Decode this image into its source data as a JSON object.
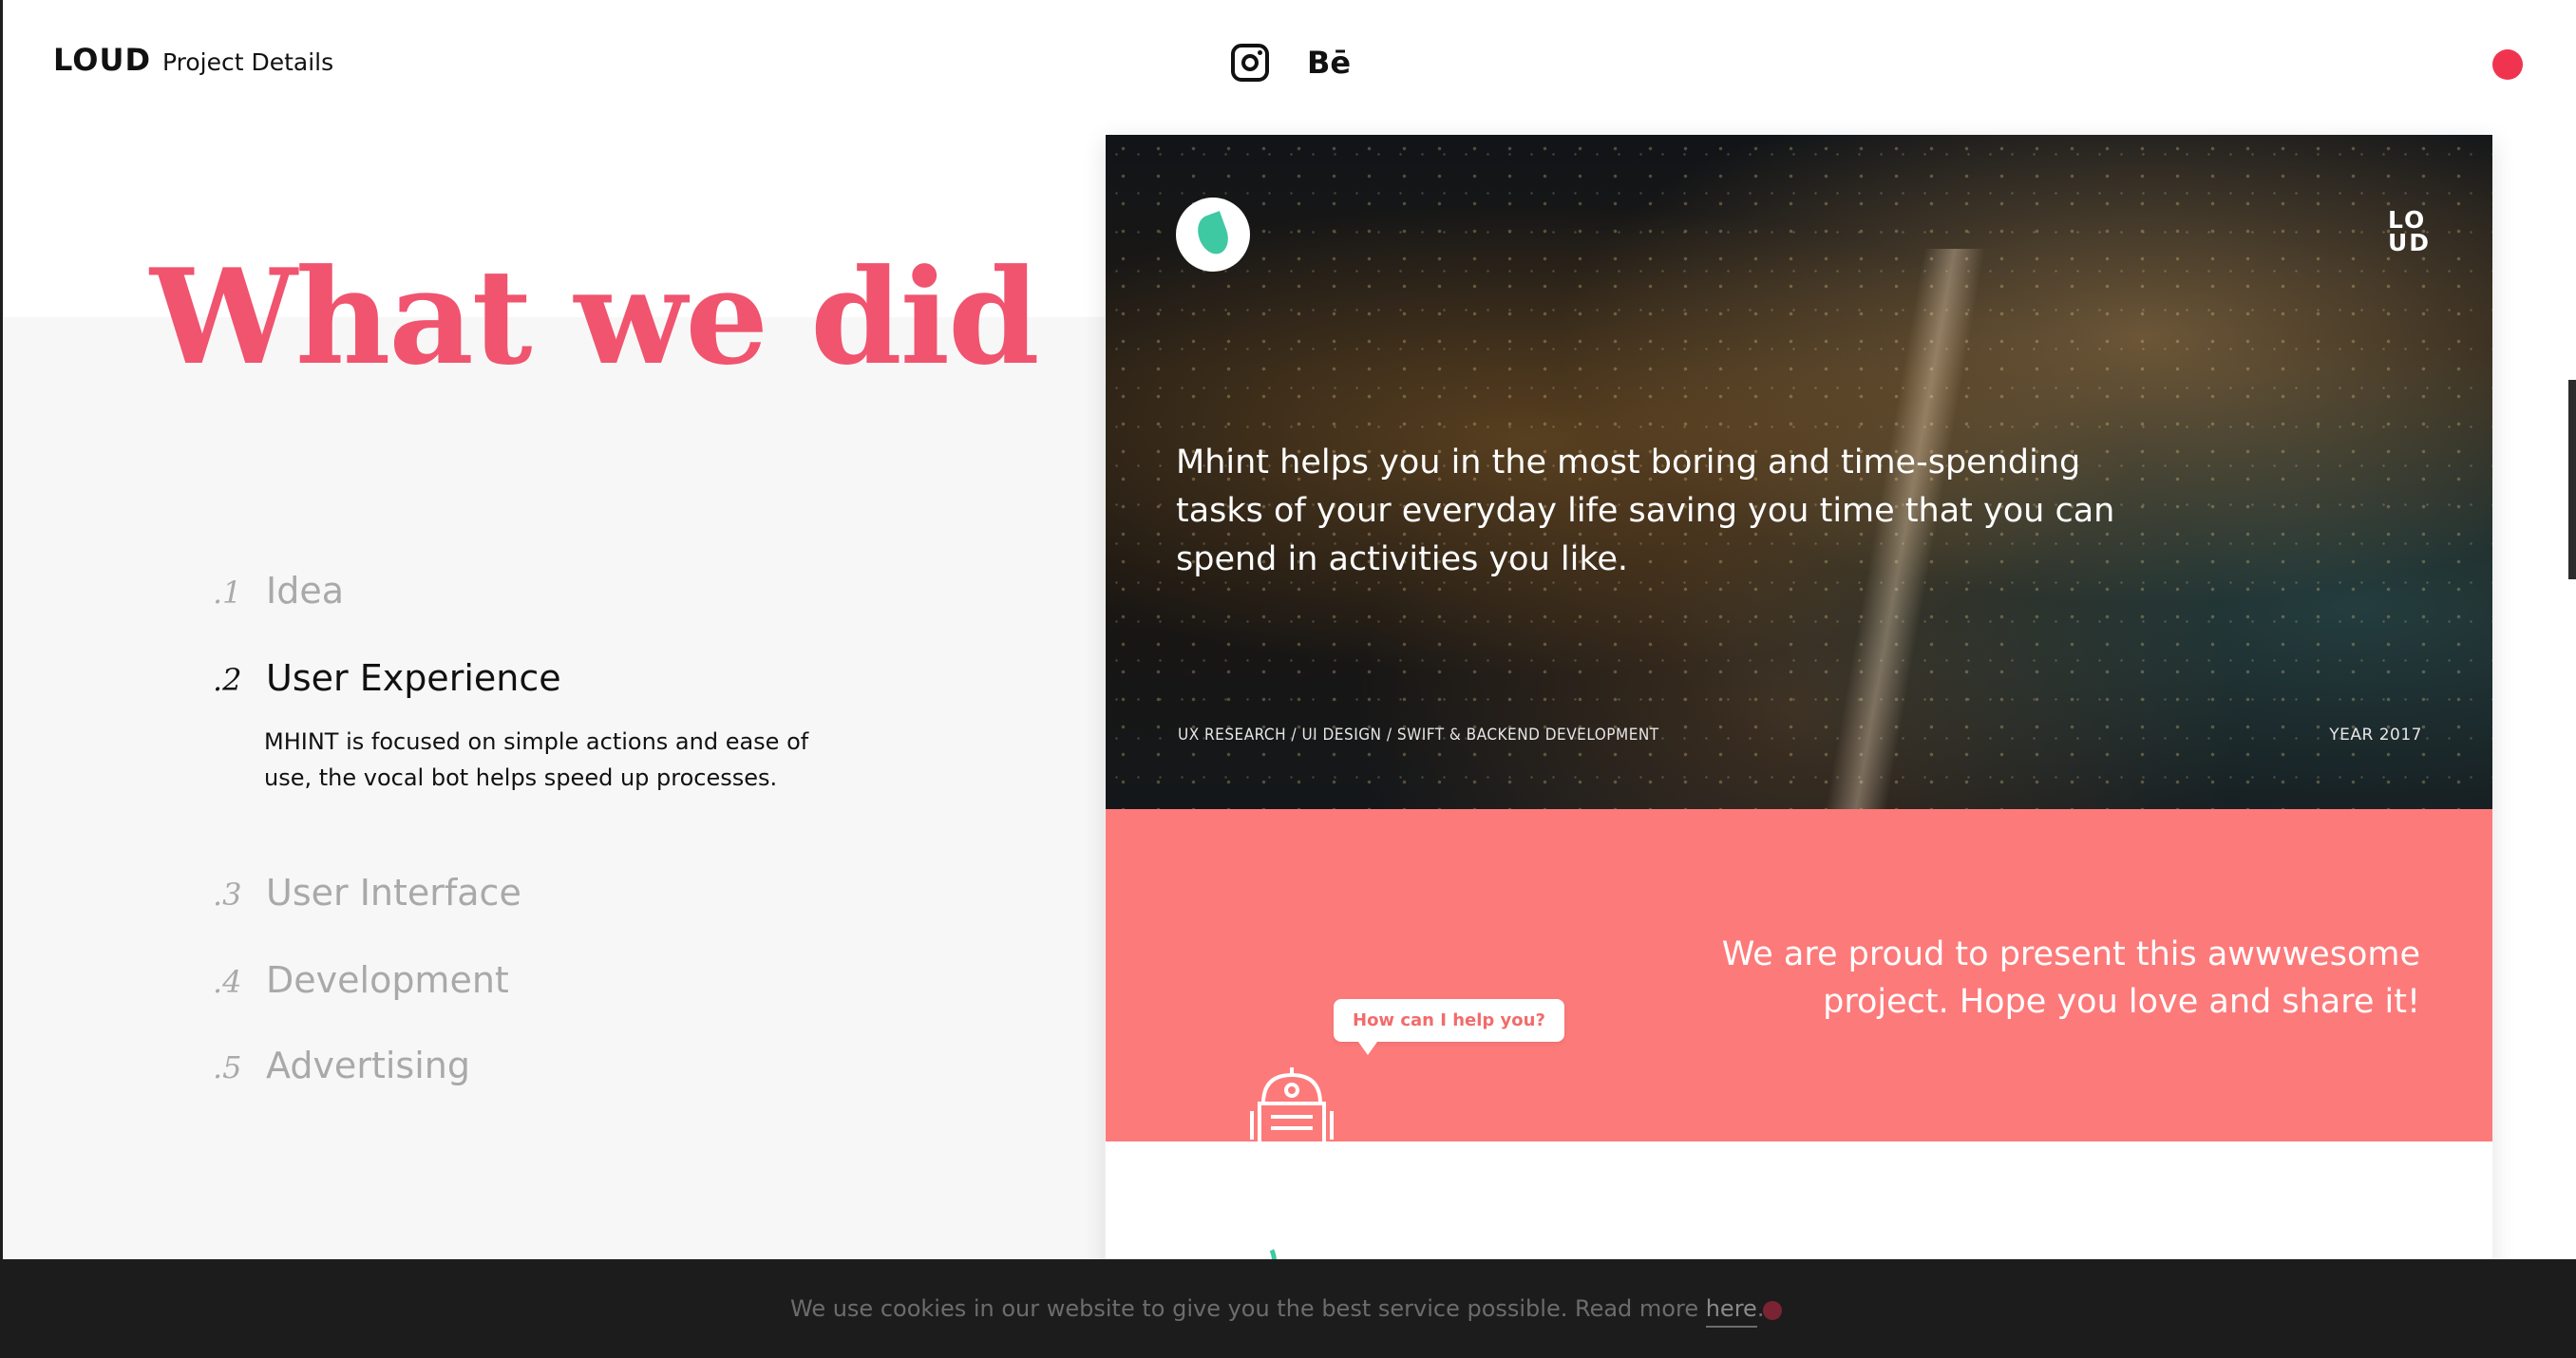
{
  "header": {
    "brand": "LOUD",
    "subtitle": "Project Details",
    "social": {
      "instagram_icon": "instagram-icon",
      "behance_label": "Bē"
    },
    "menu_dot_color": "#f0344f"
  },
  "heading": "What we did",
  "steps": [
    {
      "num": ".1",
      "label": "Idea"
    },
    {
      "num": ".2",
      "label": "User Experience",
      "description": "MHINT is focused on simple actions and ease of use, the vocal bot helps speed up processes."
    },
    {
      "num": ".3",
      "label": "User Interface"
    },
    {
      "num": ".4",
      "label": "Development"
    },
    {
      "num": ".5",
      "label": "Advertising"
    }
  ],
  "preview": {
    "hero_text": "Mhint helps you in the most boring and time-spending tasks of your everyday life saving you time that you can spend in activities you like.",
    "loud_mark": "LO UD",
    "tags": "UX RESEARCH / UI DESIGN / SWIFT & BACKEND DEVELOPMENT",
    "year": "YEAR 2017",
    "pink_text": "We are proud to present this awwwesome project. Hope you love and share it!",
    "bubble": "How can I help you?"
  },
  "cookie": {
    "text": "We use cookies in our website to give you the best service possible. Read more ",
    "link": "here",
    "suffix": "."
  },
  "colors": {
    "accent": "#f0546f",
    "pink_band": "#fd7a7a",
    "teal": "#3fc9a2"
  }
}
